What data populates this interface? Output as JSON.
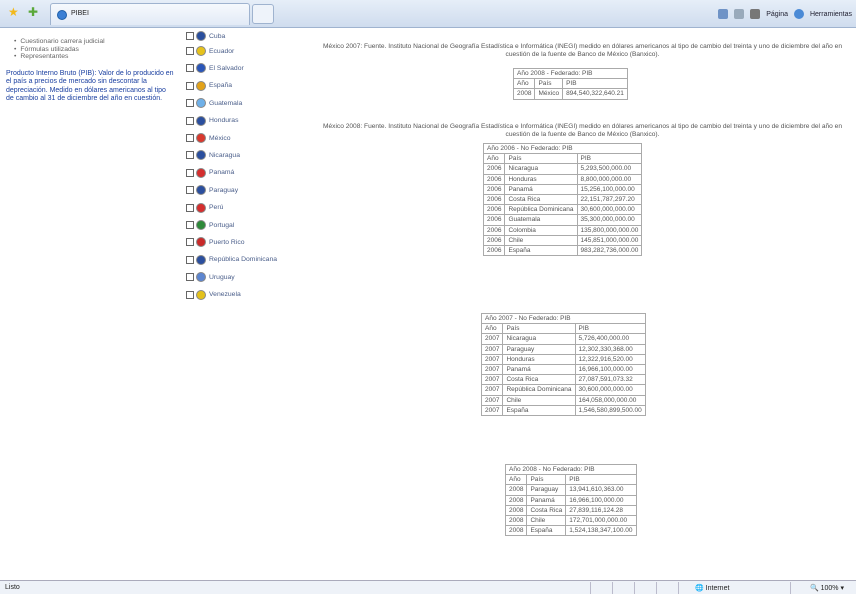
{
  "browser": {
    "tab_title": "PIBEI",
    "commands": [
      "Página",
      "Herramientas"
    ]
  },
  "sidebar": {
    "links": [
      "Cuestionario carrera judicial",
      "Fórmulas utilizadas",
      "Representantes"
    ],
    "description": "Producto Interno Bruto (PIB): Valor de lo producido en el país a precios de mercado sin descontar la depreciación. Medido en dólares americanos al tipo de cambio al 31 de diciembre del año en cuestión."
  },
  "countries": [
    {
      "name": "Cuba",
      "color": "#2a4f9e"
    },
    {
      "name": "Ecuador",
      "color": "#e6c21c"
    },
    {
      "name": "El Salvador",
      "color": "#2a56b8"
    },
    {
      "name": "España",
      "color": "#e2a21a"
    },
    {
      "name": "Guatemala",
      "color": "#6fb0e8"
    },
    {
      "name": "Honduras",
      "color": "#2b4f9e"
    },
    {
      "name": "México",
      "color": "#d8392e"
    },
    {
      "name": "Nicaragua",
      "color": "#2b4f9e"
    },
    {
      "name": "Panamá",
      "color": "#d42e2e"
    },
    {
      "name": "Paraguay",
      "color": "#2b4f9e"
    },
    {
      "name": "Perú",
      "color": "#d42e2e"
    },
    {
      "name": "Portugal",
      "color": "#2e8a3a"
    },
    {
      "name": "Puerto Rico",
      "color": "#c92a2a"
    },
    {
      "name": "República Dominicana",
      "color": "#2b4f9e"
    },
    {
      "name": "Uruguay",
      "color": "#5d86d0"
    },
    {
      "name": "Venezuela",
      "color": "#e3c11b"
    }
  ],
  "notes": {
    "mexico2007": "México 2007: Fuente. Instituto Nacional de Geografía Estadística e Informática (INEGI) medido en dólares americanos al tipo de cambio del treinta y uno de diciembre del año en cuestión de la fuente de Banco de México (Banxico).",
    "mexico2008": "México 2008: Fuente. Instituto Nacional de Geografía Estadística e Informática (INEGI) medido en dólares americanos al tipo de cambio del treinta y uno de diciembre del año en cuestión de la fuente de Banco de México (Banxico)."
  },
  "tables": {
    "federado2008": {
      "caption": "Año 2008 - Federado: PIB",
      "headers": [
        "Año",
        "País",
        "PIB"
      ],
      "rows": [
        [
          "2008",
          "México",
          "894,540,322,640.21"
        ]
      ]
    },
    "nofed2006": {
      "caption": "Año 2006 - No Federado: PIB",
      "headers": [
        "Año",
        "País",
        "PIB"
      ],
      "rows": [
        [
          "2006",
          "Nicaragua",
          "5,293,500,000.00"
        ],
        [
          "2006",
          "Honduras",
          "8,800,000,000.00"
        ],
        [
          "2006",
          "Panamá",
          "15,256,100,000.00"
        ],
        [
          "2006",
          "Costa Rica",
          "22,151,787,297.20"
        ],
        [
          "2006",
          "República Dominicana",
          "30,600,000,000.00"
        ],
        [
          "2006",
          "Guatemala",
          "35,300,000,000.00"
        ],
        [
          "2006",
          "Colombia",
          "135,800,000,000.00"
        ],
        [
          "2006",
          "Chile",
          "145,851,000,000.00"
        ],
        [
          "2006",
          "España",
          "983,282,736,000.00"
        ]
      ]
    },
    "nofed2007": {
      "caption": "Año 2007 - No Federado: PIB",
      "headers": [
        "Año",
        "País",
        "PIB"
      ],
      "rows": [
        [
          "2007",
          "Nicaragua",
          "5,726,400,000.00"
        ],
        [
          "2007",
          "Paraguay",
          "12,302,330,368.00"
        ],
        [
          "2007",
          "Honduras",
          "12,322,916,520.00"
        ],
        [
          "2007",
          "Panamá",
          "16,966,100,000.00"
        ],
        [
          "2007",
          "Costa Rica",
          "27,087,591,073.32"
        ],
        [
          "2007",
          "República Dominicana",
          "30,600,000,000.00"
        ],
        [
          "2007",
          "Chile",
          "164,058,000,000.00"
        ],
        [
          "2007",
          "España",
          "1,546,580,899,500.00"
        ]
      ]
    },
    "nofed2008": {
      "caption": "Año 2008 - No Federado: PIB",
      "headers": [
        "Año",
        "País",
        "PIB"
      ],
      "rows": [
        [
          "2008",
          "Paraguay",
          "13,941,610,363.00"
        ],
        [
          "2008",
          "Panamá",
          "16,966,100,000.00"
        ],
        [
          "2008",
          "Costa Rica",
          "27,839,116,124.28"
        ],
        [
          "2008",
          "Chile",
          "172,701,000,000.00"
        ],
        [
          "2008",
          "España",
          "1,524,138,347,100.00"
        ]
      ]
    }
  },
  "status": {
    "left": "Listo",
    "zone": "Internet",
    "zoom": "100%"
  }
}
